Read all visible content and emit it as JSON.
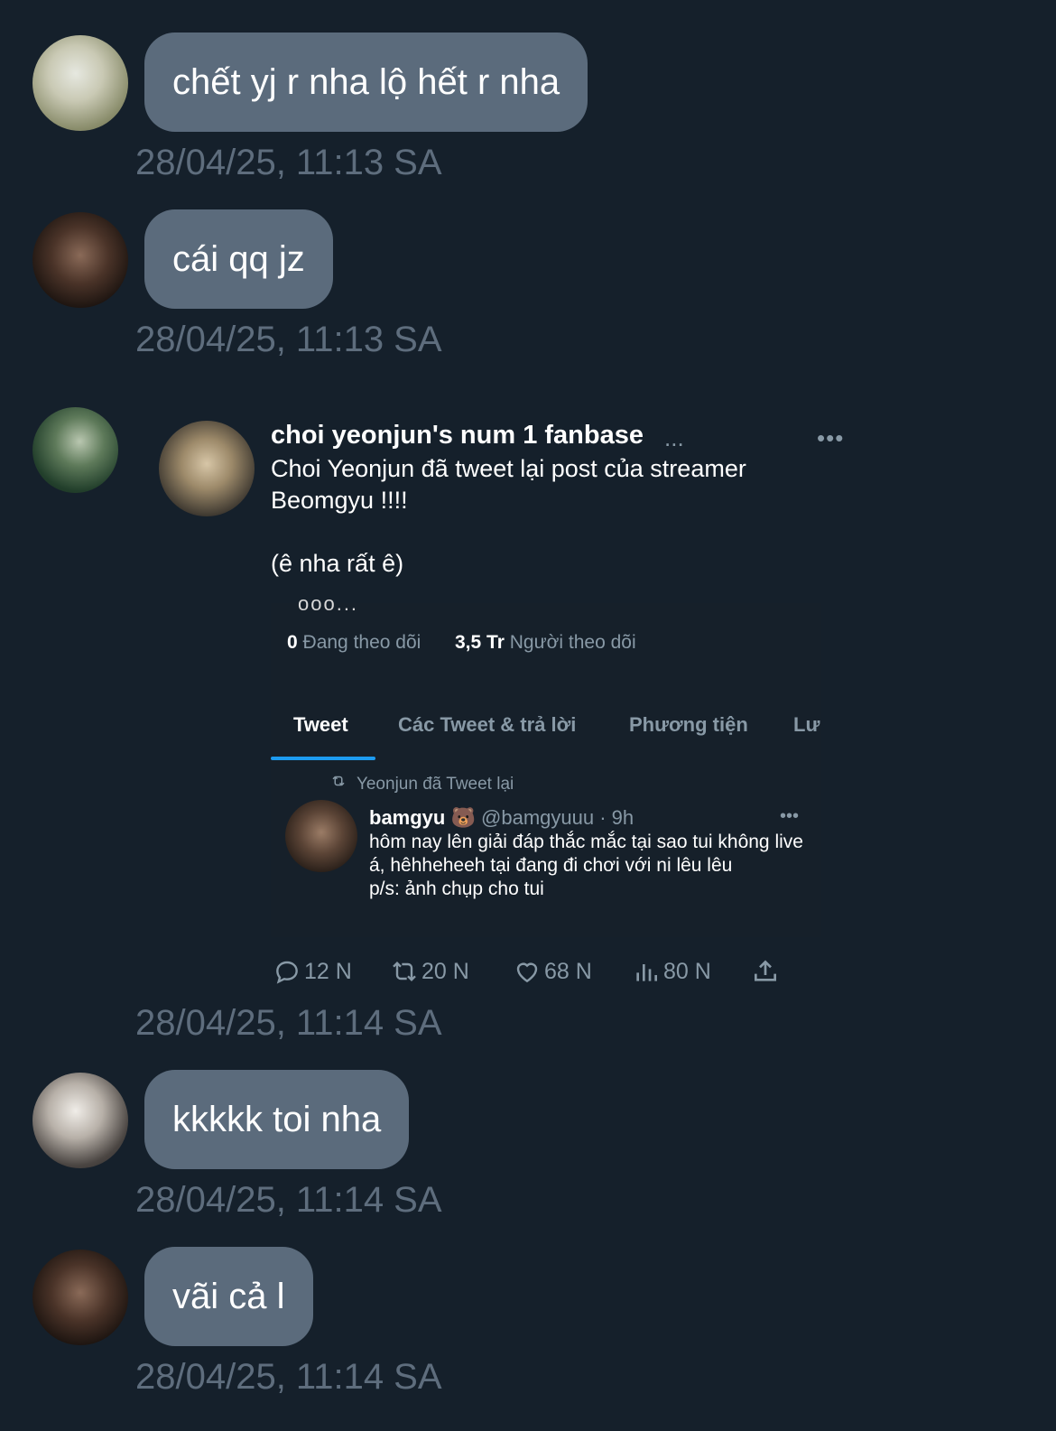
{
  "messages": [
    {
      "text": "chết yj r nha lộ hết r nha",
      "time": "28/04/25, 11:13 SA"
    },
    {
      "text": "cái qq jz",
      "time": "28/04/25, 11:13 SA"
    },
    {
      "time": "28/04/25, 11:14 SA"
    },
    {
      "text": "kkkkk toi nha",
      "time": "28/04/25, 11:14 SA"
    },
    {
      "text": "vãi cả l",
      "time": "28/04/25, 11:14 SA"
    }
  ],
  "shared_tweet": {
    "author": "choi yeonjun's num 1 fanbase",
    "author_ellipsis": "...",
    "more": "•••",
    "line1": "Choi Yeonjun đã tweet lại post của streamer Beomgyu !!!!",
    "line2": "(ê nha rất ê)",
    "screenshot": {
      "cut_text": "ooo...",
      "following_count": "0",
      "following_label": "Đang theo dõi",
      "followers_count": "3,5 Tr",
      "followers_label": "Người theo dõi",
      "tabs": [
        "Tweet",
        "Các Tweet & trả lời",
        "Phương tiện",
        "Lư"
      ],
      "retweet_label": "Yeonjun đã Tweet lại",
      "inner_tweet": {
        "name": "bamgyu",
        "emoji": "🐻",
        "handle_time": "@bamgyuuu · 9h",
        "more": "•••",
        "lines": [
          "hôm nay lên giải đáp thắc mắc tại sao tui không live á, hêhheheeh tại đang đi chơi với ni lêu lêu",
          "p/s: ảnh chụp cho tui"
        ]
      }
    },
    "actions": {
      "replies": "12 N",
      "retweets": "20 N",
      "likes": "68 N",
      "views": "80 N"
    }
  }
}
